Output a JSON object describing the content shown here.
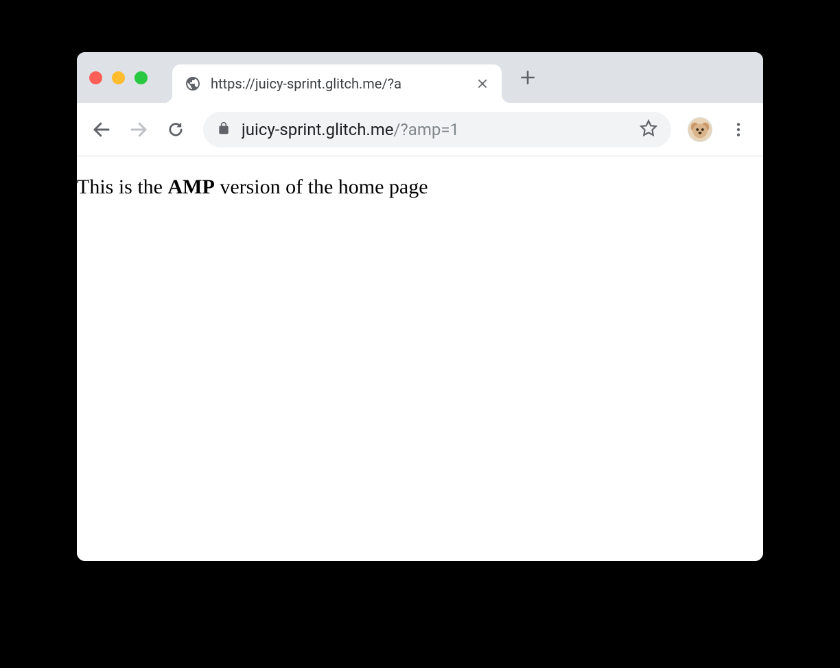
{
  "tab": {
    "title": "https://juicy-sprint.glitch.me/?a"
  },
  "address": {
    "domain": "juicy-sprint.glitch.me",
    "query": "/?amp=1"
  },
  "page": {
    "text_prefix": "This is the ",
    "text_bold": "AMP",
    "text_suffix": " version of the home page"
  }
}
